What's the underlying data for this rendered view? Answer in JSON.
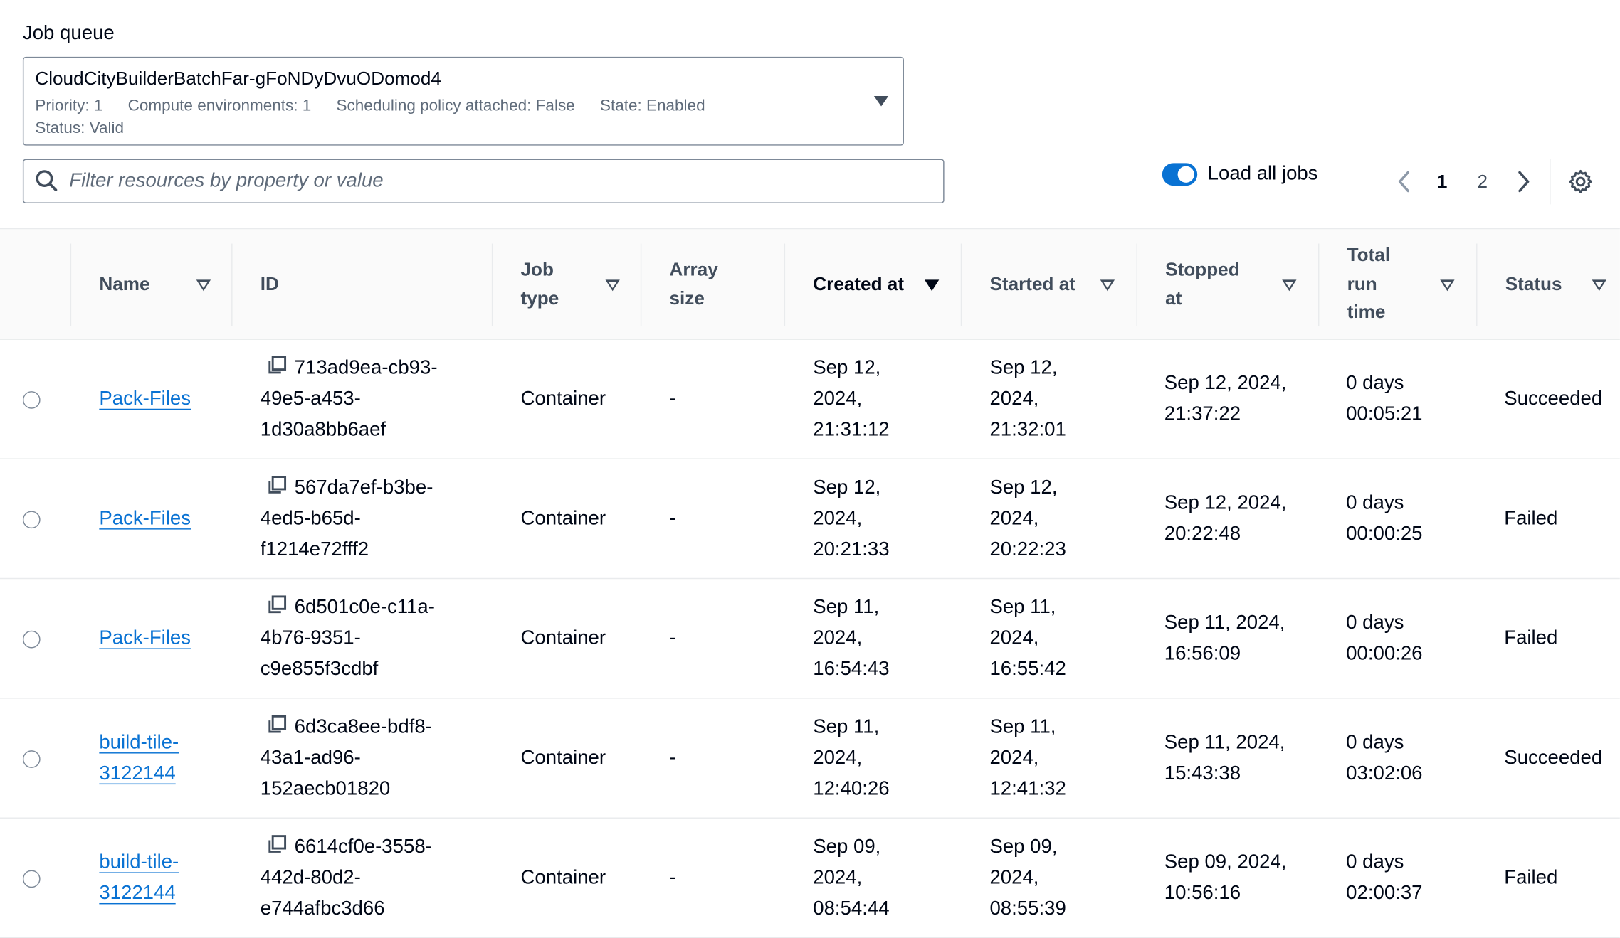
{
  "job_queue": {
    "label": "Job queue",
    "name": "CloudCityBuilderBatchFar-gFoNDyDvuODomod4",
    "priority": "Priority: 1",
    "compute_envs": "Compute environments: 1",
    "scheduling": "Scheduling policy attached: False",
    "state": "State: Enabled",
    "status": "Status: Valid"
  },
  "filter": {
    "placeholder": "Filter resources by property or value"
  },
  "load_all": {
    "label": "Load all jobs",
    "enabled": true
  },
  "pagination": {
    "page1": "1",
    "page2": "2",
    "current": 1
  },
  "columns": {
    "name": "Name",
    "id": "ID",
    "job_type": [
      "Job",
      "type"
    ],
    "array_size": [
      "Array",
      "size"
    ],
    "created": "Created at",
    "started": "Started at",
    "stopped": [
      "Stopped",
      "at"
    ],
    "total": [
      "Total",
      "run",
      "time"
    ],
    "status": "Status"
  },
  "rows": [
    {
      "name": [
        "Pack-Files"
      ],
      "id": [
        "713ad9ea-cb93-",
        "49e5-a453-",
        "1d30a8bb6aef"
      ],
      "type": "Container",
      "array": "-",
      "created": [
        "Sep 12,",
        "2024,",
        "21:31:12"
      ],
      "started": [
        "Sep 12,",
        "2024,",
        "21:32:01"
      ],
      "stopped": [
        "Sep 12, 2024,",
        "21:37:22"
      ],
      "total": [
        "0 days",
        "00:05:21"
      ],
      "status": "Succeeded"
    },
    {
      "name": [
        "Pack-Files"
      ],
      "id": [
        "567da7ef-b3be-",
        "4ed5-b65d-",
        "f1214e72fff2"
      ],
      "type": "Container",
      "array": "-",
      "created": [
        "Sep 12,",
        "2024,",
        "20:21:33"
      ],
      "started": [
        "Sep 12,",
        "2024,",
        "20:22:23"
      ],
      "stopped": [
        "Sep 12, 2024,",
        "20:22:48"
      ],
      "total": [
        "0 days",
        "00:00:25"
      ],
      "status": "Failed"
    },
    {
      "name": [
        "Pack-Files"
      ],
      "id": [
        "6d501c0e-c11a-",
        "4b76-9351-",
        "c9e855f3cdbf"
      ],
      "type": "Container",
      "array": "-",
      "created": [
        "Sep 11,",
        "2024,",
        "16:54:43"
      ],
      "started": [
        "Sep 11,",
        "2024,",
        "16:55:42"
      ],
      "stopped": [
        "Sep 11, 2024,",
        "16:56:09"
      ],
      "total": [
        "0 days",
        "00:00:26"
      ],
      "status": "Failed"
    },
    {
      "name": [
        "build-tile-",
        "3122144"
      ],
      "id": [
        "6d3ca8ee-bdf8-",
        "43a1-ad96-",
        "152aecb01820"
      ],
      "type": "Container",
      "array": "-",
      "created": [
        "Sep 11,",
        "2024,",
        "12:40:26"
      ],
      "started": [
        "Sep 11,",
        "2024,",
        "12:41:32"
      ],
      "stopped": [
        "Sep 11, 2024,",
        "15:43:38"
      ],
      "total": [
        "0 days",
        "03:02:06"
      ],
      "status": "Succeeded"
    },
    {
      "name": [
        "build-tile-",
        "3122144"
      ],
      "id": [
        "6614cf0e-3558-",
        "442d-80d2-",
        "e744afbc3d66"
      ],
      "type": "Container",
      "array": "-",
      "created": [
        "Sep 09,",
        "2024,",
        "08:54:44"
      ],
      "started": [
        "Sep 09,",
        "2024,",
        "08:55:39"
      ],
      "stopped": [
        "Sep 09, 2024,",
        "10:56:16"
      ],
      "total": [
        "0 days",
        "02:00:37"
      ],
      "status": "Failed"
    }
  ]
}
